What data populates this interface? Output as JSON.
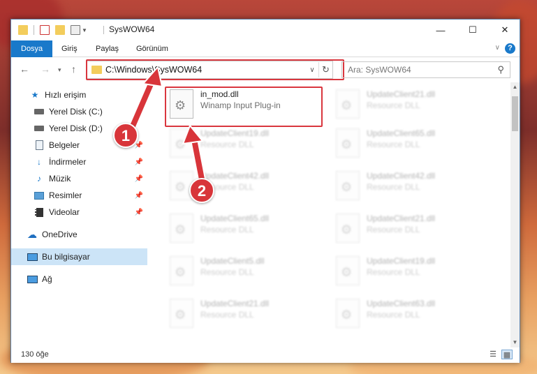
{
  "window": {
    "title": "SysWOW64",
    "controls": {
      "minimize": "—",
      "maximize": "☐",
      "close": "✕"
    }
  },
  "ribbon": {
    "tabs": [
      {
        "label": "Dosya",
        "active": true
      },
      {
        "label": "Giriş",
        "active": false
      },
      {
        "label": "Paylaş",
        "active": false
      },
      {
        "label": "Görünüm",
        "active": false
      }
    ],
    "help": "?"
  },
  "address_bar": {
    "path": "C:\\Windows\\SysWOW64"
  },
  "search": {
    "placeholder": "Ara: SysWOW64"
  },
  "sidebar": {
    "items": [
      {
        "label": "Hızlı erişim",
        "icon": "star-icon",
        "pinned": false
      },
      {
        "label": "Yerel Disk (C:)",
        "icon": "drive-icon",
        "pinned": false
      },
      {
        "label": "Yerel Disk (D:)",
        "icon": "drive-icon",
        "pinned": false
      },
      {
        "label": "Belgeler",
        "icon": "document-icon",
        "pinned": true
      },
      {
        "label": "İndirmeler",
        "icon": "download-icon",
        "pinned": true
      },
      {
        "label": "Müzik",
        "icon": "music-icon",
        "pinned": true
      },
      {
        "label": "Resimler",
        "icon": "pictures-icon",
        "pinned": true
      },
      {
        "label": "Videolar",
        "icon": "video-icon",
        "pinned": true
      },
      {
        "label": "OneDrive",
        "icon": "cloud-icon",
        "pinned": false
      },
      {
        "label": "Bu bilgisayar",
        "icon": "computer-icon",
        "pinned": false,
        "selected": true
      },
      {
        "label": "Ağ",
        "icon": "network-icon",
        "pinned": false
      }
    ]
  },
  "files": {
    "highlighted": {
      "name": "in_mod.dll",
      "type": "Winamp Input Plug-in"
    },
    "left_column": [
      {
        "name": "UpdateClient19.dll",
        "type": "Resource DLL"
      },
      {
        "name": "UpdateClient42.dll",
        "type": "Resource DLL"
      },
      {
        "name": "UpdateClient65.dll",
        "type": "Resource DLL"
      },
      {
        "name": "UpdateClient5.dll",
        "type": "Resource DLL"
      },
      {
        "name": "UpdateClient21.dll",
        "type": "Resource DLL"
      }
    ],
    "right_column": [
      {
        "name": "UpdateClient21.dll",
        "type": "Resource DLL"
      },
      {
        "name": "UpdateClient65.dll",
        "type": "Resource DLL"
      },
      {
        "name": "UpdateClient42.dll",
        "type": "Resource DLL"
      },
      {
        "name": "UpdateClient21.dll",
        "type": "Resource DLL"
      },
      {
        "name": "UpdateClient19.dll",
        "type": "Resource DLL"
      },
      {
        "name": "UpdateClient63.dll",
        "type": "Resource DLL"
      }
    ]
  },
  "status": {
    "count": "130 öğe"
  },
  "annotations": [
    {
      "label": "1"
    },
    {
      "label": "2"
    }
  ],
  "colors": {
    "accent": "#1979ca",
    "highlight_red": "#d9363e",
    "selected_bg": "#cce4f7"
  }
}
